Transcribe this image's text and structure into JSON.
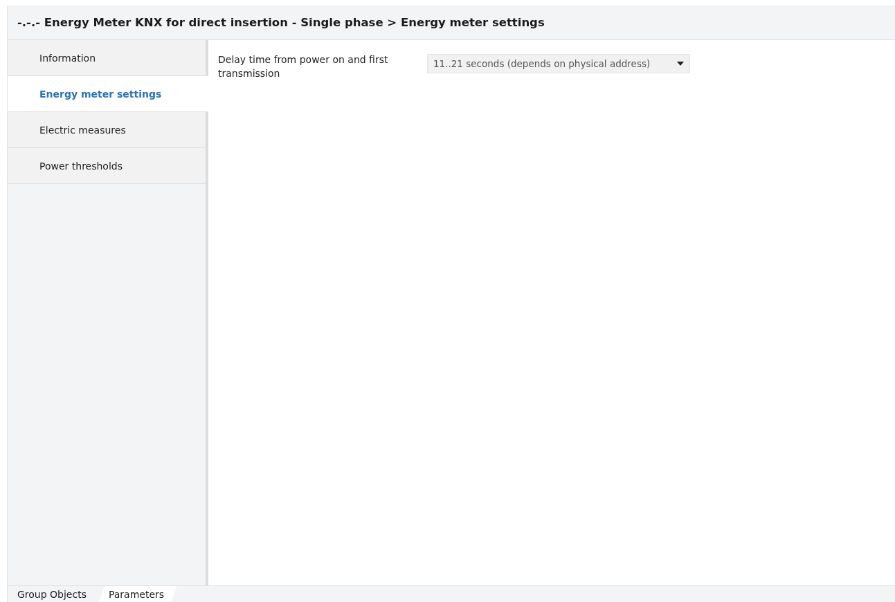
{
  "header": {
    "title": "-.-.- Energy Meter KNX for direct insertion - Single phase > Energy meter settings"
  },
  "sidebar": {
    "items": [
      {
        "label": "Information",
        "selected": false
      },
      {
        "label": "Energy meter settings",
        "selected": true
      },
      {
        "label": "Electric measures",
        "selected": false
      },
      {
        "label": "Power thresholds",
        "selected": false
      }
    ]
  },
  "parameters": [
    {
      "label": "Delay time from power on and first transmission",
      "value": "11..21 seconds (depends on physical address)"
    }
  ],
  "bottom_tabs": [
    {
      "label": "Group Objects",
      "selected": false
    },
    {
      "label": "Parameters",
      "selected": true
    }
  ]
}
